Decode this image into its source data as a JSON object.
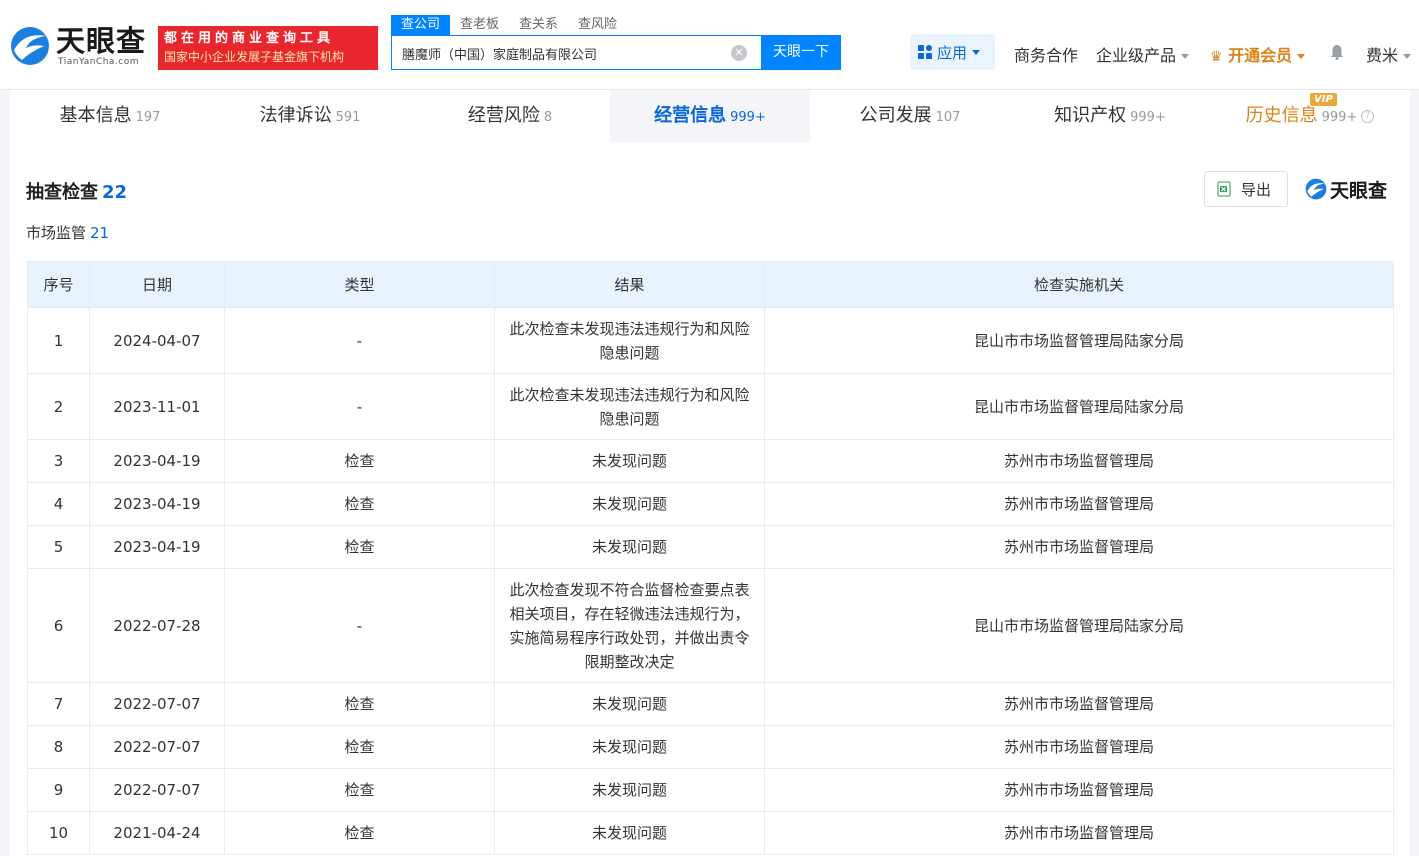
{
  "header": {
    "logo_text": "天眼查",
    "logo_sub": "TianYanCha.com",
    "slogan_line1": "都在用的商业查询工具",
    "slogan_line2": "国家中小企业发展子基金旗下机构",
    "search_tabs": [
      "查公司",
      "查老板",
      "查关系",
      "查风险"
    ],
    "search_value": "膳魔师（中国）家庭制品有限公司",
    "search_button": "天眼一下",
    "nav": {
      "app": "应用",
      "business": "商务合作",
      "enterprise": "企业级产品",
      "vip": "开通会员",
      "user": "费米"
    }
  },
  "tabs": [
    {
      "label": "基本信息",
      "count": "197"
    },
    {
      "label": "法律诉讼",
      "count": "591"
    },
    {
      "label": "经营风险",
      "count": "8"
    },
    {
      "label": "经营信息",
      "count": "999+"
    },
    {
      "label": "公司发展",
      "count": "107"
    },
    {
      "label": "知识产权",
      "count": "999+"
    },
    {
      "label": "历史信息",
      "count": "999+",
      "badge": "VIP"
    }
  ],
  "section": {
    "title": "抽查检查",
    "count": "22",
    "subtitle": "市场监管",
    "sub_count": "21",
    "export": "导出",
    "brand": "天眼查"
  },
  "table": {
    "headers": [
      "序号",
      "日期",
      "类型",
      "结果",
      "检查实施机关"
    ],
    "rows": [
      {
        "no": "1",
        "date": "2024-04-07",
        "type": "-",
        "result": "此次检查未发现违法违规行为和风险隐患问题",
        "agency": "昆山市市场监督管理局陆家分局"
      },
      {
        "no": "2",
        "date": "2023-11-01",
        "type": "-",
        "result": "此次检查未发现违法违规行为和风险隐患问题",
        "agency": "昆山市市场监督管理局陆家分局"
      },
      {
        "no": "3",
        "date": "2023-04-19",
        "type": "检查",
        "result": "未发现问题",
        "agency": "苏州市市场监督管理局"
      },
      {
        "no": "4",
        "date": "2023-04-19",
        "type": "检查",
        "result": "未发现问题",
        "agency": "苏州市市场监督管理局"
      },
      {
        "no": "5",
        "date": "2023-04-19",
        "type": "检查",
        "result": "未发现问题",
        "agency": "苏州市市场监督管理局"
      },
      {
        "no": "6",
        "date": "2022-07-28",
        "type": "-",
        "result": "此次检查发现不符合监督检查要点表相关项目，存在轻微违法违规行为，实施简易程序行政处罚，并做出责令限期整改决定",
        "agency": "昆山市市场监督管理局陆家分局"
      },
      {
        "no": "7",
        "date": "2022-07-07",
        "type": "检查",
        "result": "未发现问题",
        "agency": "苏州市市场监督管理局"
      },
      {
        "no": "8",
        "date": "2022-07-07",
        "type": "检查",
        "result": "未发现问题",
        "agency": "苏州市市场监督管理局"
      },
      {
        "no": "9",
        "date": "2022-07-07",
        "type": "检查",
        "result": "未发现问题",
        "agency": "苏州市市场监督管理局"
      },
      {
        "no": "10",
        "date": "2021-04-24",
        "type": "检查",
        "result": "未发现问题",
        "agency": "苏州市市场监督管理局"
      }
    ]
  },
  "colors": {
    "accent": "#0084ff",
    "brand_blue": "#0a67d8",
    "slogan_red": "#e8262d",
    "vip_orange": "#d9841a",
    "header_row_bg": "#e9f3fd"
  }
}
